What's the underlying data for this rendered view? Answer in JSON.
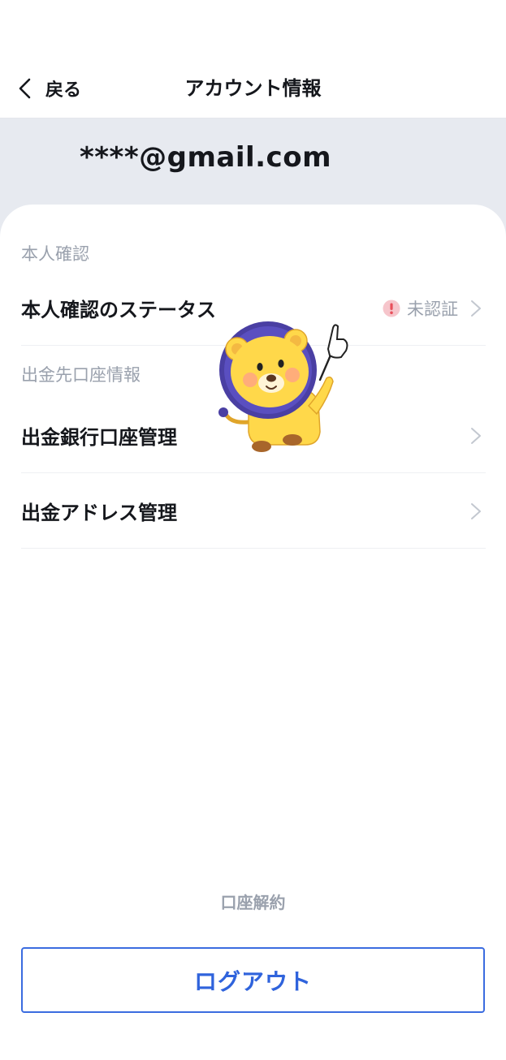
{
  "header": {
    "back_label": "戻る",
    "title": "アカウント情報",
    "back_icon": "chevron-left-icon"
  },
  "account": {
    "email": "****@gmail.com"
  },
  "sections": {
    "identity": {
      "label": "本人確認",
      "status_row": {
        "label": "本人確認のステータス",
        "status": "未認証",
        "status_icon": "exclamation-circle-icon",
        "status_icon_color": "#e8505b"
      }
    },
    "withdrawal": {
      "label": "出金先口座情報",
      "rows": [
        {
          "label": "出金銀行口座管理"
        },
        {
          "label": "出金アドレス管理"
        }
      ]
    }
  },
  "mascot": {
    "icon": "lion-mascot-icon"
  },
  "footer": {
    "close_account_label": "口座解約",
    "logout_label": "ログアウト"
  },
  "colors": {
    "accent": "#2f63dc",
    "muted_text": "#9aa1ad",
    "band_background": "#e7eaf0",
    "alert": "#e8505b"
  }
}
